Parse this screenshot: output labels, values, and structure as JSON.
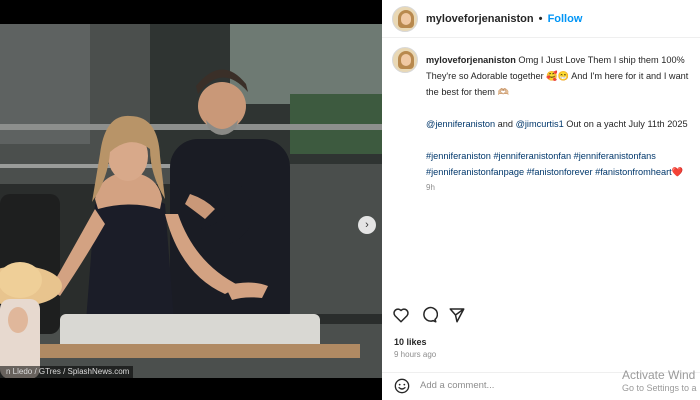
{
  "post": {
    "username": "myloveforjenaniston",
    "separator": "•",
    "follow_label": "Follow",
    "caption_line1": "Omg I Just Love Them I ship them 100% They're so Adorable together 🥰😁 And I'm here for it and I want the best for them 🫶🏼",
    "mention1": "@jenniferaniston",
    "and_text": "and",
    "mention2": "@jimcurtis1",
    "yacht_text": "Out on a yacht July 11th 2025",
    "hashtags": [
      "#jenniferaniston",
      "#jenniferanistonfan",
      "#jenniferanistonfans",
      "#jenniferanistonfanpage",
      "#fanistonforever",
      "#fanistonfromheart"
    ],
    "heart_glyph": "❤️",
    "caption_time": "9h",
    "likes": "10 likes",
    "posted_ago": "9 hours ago"
  },
  "media": {
    "credit": "n Lledo / GTres / SplashNews.com",
    "next_glyph": "›"
  },
  "actions": {
    "like_icon": "heart-outline-icon",
    "comment_icon": "comment-bubble-icon",
    "share_icon": "paper-plane-icon"
  },
  "comment": {
    "placeholder": "Add a comment...",
    "emoji_icon": "smiley-icon"
  },
  "watermark": {
    "line1": "Activate Wind",
    "line2": "Go to Settings to a"
  }
}
